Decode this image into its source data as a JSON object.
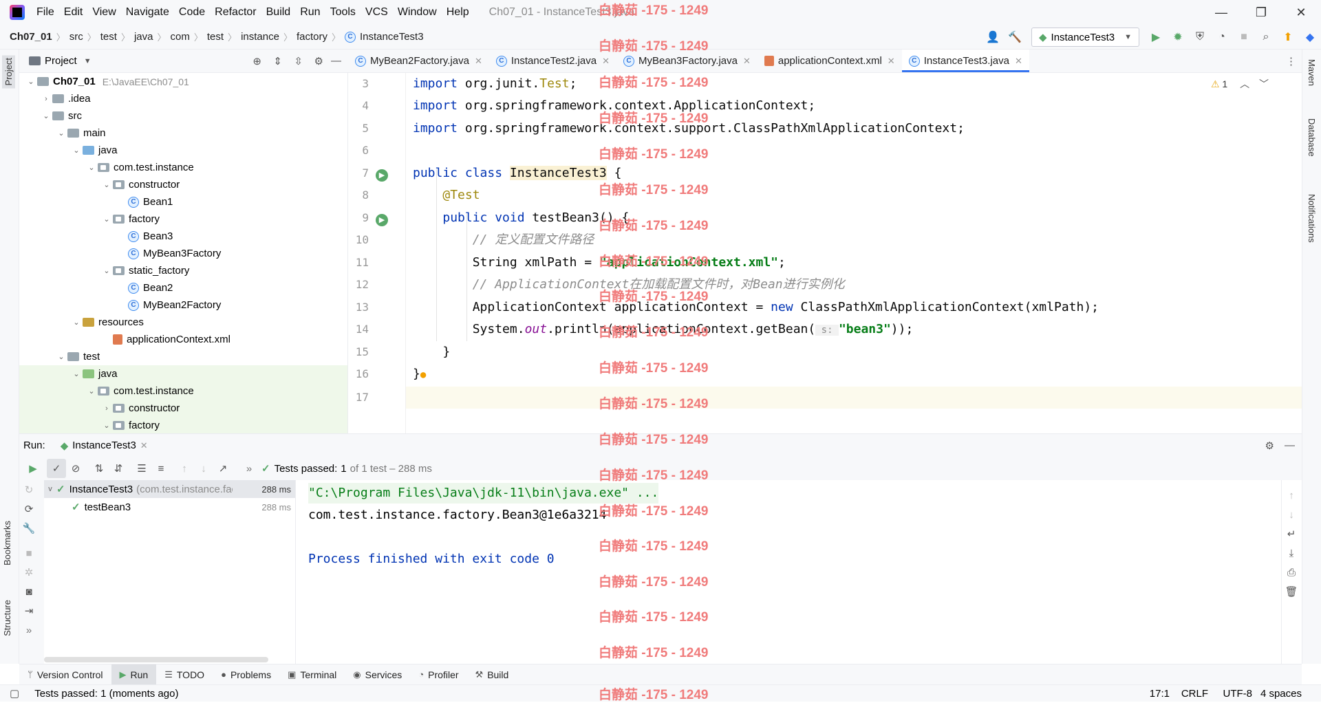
{
  "menubar": {
    "items": [
      "File",
      "Edit",
      "View",
      "Navigate",
      "Code",
      "Refactor",
      "Build",
      "Run",
      "Tools",
      "VCS",
      "Window",
      "Help"
    ],
    "window_title": "Ch07_01 - InstanceTest3.java",
    "minimize": "—",
    "maximize": "❐",
    "close": "✕"
  },
  "breadcrumbs": [
    "Ch07_01",
    "src",
    "test",
    "java",
    "com",
    "test",
    "instance",
    "factory",
    "InstanceTest3"
  ],
  "toolbar": {
    "run_config": "InstanceTest3"
  },
  "project_panel": {
    "title": "Project",
    "tree": [
      {
        "label": "Ch07_01",
        "extra": "E:\\JavaEE\\Ch07_01",
        "indent": 0,
        "arrow": "v",
        "icon": "folder",
        "bold": true
      },
      {
        "label": ".idea",
        "indent": 1,
        "arrow": ">",
        "icon": "folder"
      },
      {
        "label": "src",
        "indent": 1,
        "arrow": "v",
        "icon": "folder"
      },
      {
        "label": "main",
        "indent": 2,
        "arrow": "v",
        "icon": "folder"
      },
      {
        "label": "java",
        "indent": 3,
        "arrow": "v",
        "icon": "src"
      },
      {
        "label": "com.test.instance",
        "indent": 4,
        "arrow": "v",
        "icon": "pkg"
      },
      {
        "label": "constructor",
        "indent": 5,
        "arrow": "v",
        "icon": "pkg"
      },
      {
        "label": "Bean1",
        "indent": 6,
        "arrow": "",
        "icon": "class"
      },
      {
        "label": "factory",
        "indent": 5,
        "arrow": "v",
        "icon": "pkg"
      },
      {
        "label": "Bean3",
        "indent": 6,
        "arrow": "",
        "icon": "class"
      },
      {
        "label": "MyBean3Factory",
        "indent": 6,
        "arrow": "",
        "icon": "class"
      },
      {
        "label": "static_factory",
        "indent": 5,
        "arrow": "v",
        "icon": "pkg"
      },
      {
        "label": "Bean2",
        "indent": 6,
        "arrow": "",
        "icon": "class"
      },
      {
        "label": "MyBean2Factory",
        "indent": 6,
        "arrow": "",
        "icon": "class"
      },
      {
        "label": "resources",
        "indent": 3,
        "arrow": "v",
        "icon": "res"
      },
      {
        "label": "applicationContext.xml",
        "indent": 5,
        "arrow": "",
        "icon": "xml"
      },
      {
        "label": "test",
        "indent": 2,
        "arrow": "v",
        "icon": "folder"
      },
      {
        "label": "java",
        "indent": 3,
        "arrow": "v",
        "icon": "tst",
        "green": true
      },
      {
        "label": "com.test.instance",
        "indent": 4,
        "arrow": "v",
        "icon": "pkg",
        "green": true
      },
      {
        "label": "constructor",
        "indent": 5,
        "arrow": ">",
        "icon": "pkg",
        "green": true
      },
      {
        "label": "factory",
        "indent": 5,
        "arrow": "v",
        "icon": "pkg",
        "green": true
      }
    ]
  },
  "editor_tabs": [
    {
      "label": "MyBean2Factory.java",
      "active": false
    },
    {
      "label": "InstanceTest2.java",
      "active": false
    },
    {
      "label": "MyBean3Factory.java",
      "active": false
    },
    {
      "label": "applicationContext.xml",
      "active": false
    },
    {
      "label": "InstanceTest3.java",
      "active": true
    }
  ],
  "editor": {
    "warning_count": "1",
    "line_numbers": [
      "3",
      "4",
      "5",
      "6",
      "7",
      "8",
      "9",
      "10",
      "11",
      "12",
      "13",
      "14",
      "15",
      "16",
      "17"
    ]
  },
  "run_panel": {
    "label": "Run:",
    "tab": "InstanceTest3",
    "tests_passed_prefix": "Tests passed:",
    "tests_passed_count": "1",
    "tests_passed_suffix": "of 1 test – 288 ms",
    "tree": [
      {
        "label": "InstanceTest3",
        "extra": "(com.test.instance.fac",
        "time": "288 ms"
      },
      {
        "label": "testBean3",
        "time": "288 ms"
      }
    ],
    "console": [
      "\"C:\\Program Files\\Java\\jdk-11\\bin\\java.exe\" ...",
      "com.test.instance.factory.Bean3@1e6a3214",
      "",
      "Process finished with exit code 0"
    ]
  },
  "bottom_tabs": [
    "Version Control",
    "Run",
    "TODO",
    "Problems",
    "Terminal",
    "Services",
    "Profiler",
    "Build"
  ],
  "left_strip": [
    "Project",
    "Bookmarks",
    "Structure"
  ],
  "right_strip": [
    "Maven",
    "Database",
    "Notifications"
  ],
  "status": {
    "message": "Tests passed: 1 (moments ago)",
    "position": "17:1",
    "line_sep": "CRLF",
    "encoding": "UTF-8",
    "indent": "4 spaces"
  },
  "watermark": "白静茹 -175 - 1249",
  "colors": {
    "keyword": "#0033b3",
    "string": "#067d17",
    "annotation": "#9e880d",
    "comment": "#8c8c8c",
    "accent": "#3574f0",
    "pass": "#59a869"
  }
}
